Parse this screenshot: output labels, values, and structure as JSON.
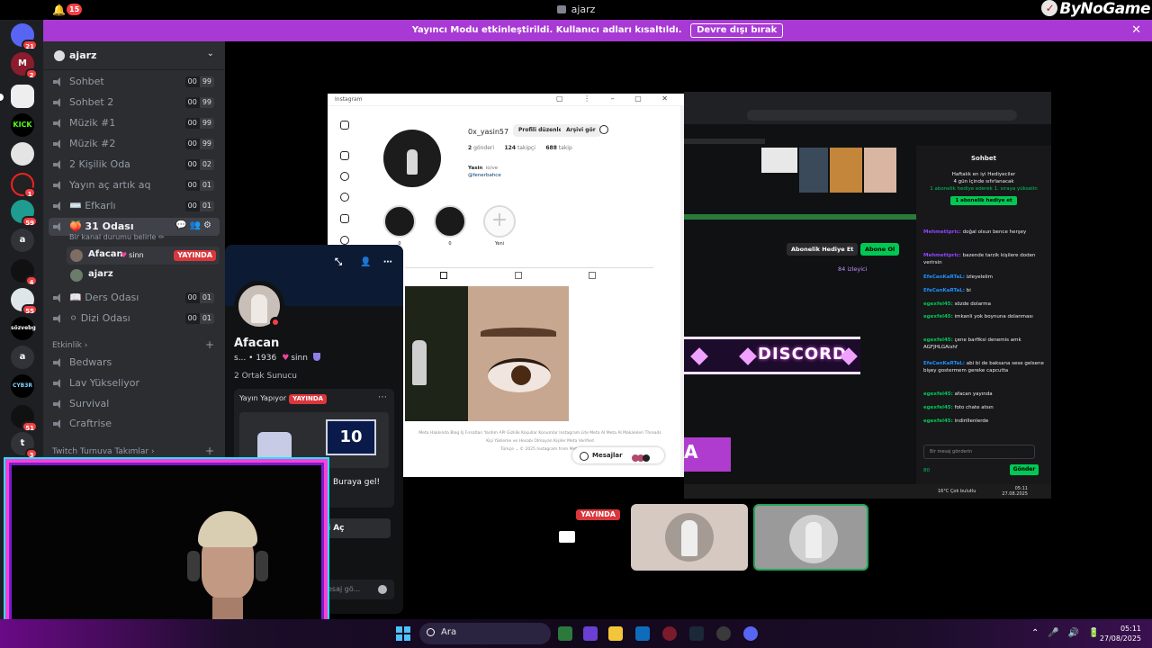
{
  "titlebar": {
    "notification_count": "15",
    "title": "ajarz",
    "watermark": "ByNoGame"
  },
  "banner": {
    "message": "Yayıncı Modu etkinleştirildi. Kullanıcı adları kısaltıldı.",
    "disable_label": "Devre dışı bırak",
    "close_glyph": "✕"
  },
  "rail": {
    "servers": [
      {
        "abbr": "",
        "badge": "21"
      },
      {
        "abbr": "M",
        "badge": "2"
      },
      {
        "abbr": "",
        "badge": ""
      },
      {
        "abbr": "KICK",
        "badge": ""
      },
      {
        "abbr": "",
        "badge": ""
      },
      {
        "abbr": "",
        "badge": "1"
      },
      {
        "abbr": "",
        "badge": "59"
      },
      {
        "abbr": "a",
        "badge": ""
      },
      {
        "abbr": "",
        "badge": "4"
      },
      {
        "abbr": "",
        "badge": "55"
      },
      {
        "abbr": "sözvebg",
        "badge": ""
      },
      {
        "abbr": "a",
        "badge": ""
      },
      {
        "abbr": "CYB3R",
        "badge": ""
      },
      {
        "abbr": "",
        "badge": "51"
      },
      {
        "abbr": "t",
        "badge": "3"
      }
    ]
  },
  "sidebar": {
    "server_name": "ajarz",
    "channels": [
      {
        "name": "Sohbet",
        "count": "00",
        "limit": "99"
      },
      {
        "name": "Sohbet 2",
        "count": "00",
        "limit": "99"
      },
      {
        "name": "Müzik #1",
        "count": "00",
        "limit": "99"
      },
      {
        "name": "Müzik #2",
        "count": "00",
        "limit": "99"
      },
      {
        "name": "2 Kişilik Oda",
        "count": "00",
        "limit": "02"
      },
      {
        "name": "Yayın aç artık aq",
        "count": "00",
        "limit": "01"
      },
      {
        "name": "⌨️ Efkarlı",
        "count": "00",
        "limit": "01"
      },
      {
        "name": "🍑 31 Odası",
        "count": "",
        "limit": ""
      },
      {
        "name": "📖 Ders Odası",
        "count": "00",
        "limit": "01"
      },
      {
        "name": "⚪ Dizi Odası",
        "count": "00",
        "limit": "01"
      }
    ],
    "active_channel_status": "Bir kanal durumu belirle ✏",
    "voice_users": [
      {
        "name": "Afacan",
        "tag": "sinn",
        "live": "YAYINDA"
      },
      {
        "name": "ajarz",
        "tag": "",
        "live": ""
      }
    ],
    "category_1": "Etkinlik ›",
    "category_1_channels": [
      "Bedwars",
      "Lav Yükseliyor",
      "Survival",
      "Craftrise"
    ],
    "category_2": "Twitch Turnuva Takımlar ›"
  },
  "instagram": {
    "window_title": "Instagram",
    "window_controls": "▢ ⋮ – ▢ ✕",
    "username": "0x_yasin57",
    "edit_profile": "Profili düzenle",
    "view_archive": "Arşivi gör",
    "stats": {
      "posts": "2",
      "posts_label": "gönderi",
      "followers": "124",
      "followers_label": "takipçi",
      "following": "688",
      "following_label": "takip"
    },
    "bio_name": "Yasin",
    "bio_pronoun": "io/ve",
    "bio_link": "@fenerbahce",
    "highlights": [
      {
        "label": "0"
      },
      {
        "label": "0"
      },
      {
        "label": "Yeni"
      }
    ],
    "footer_line1": "Meta  Hakkında  Blog  İş Fırsatları  Yardım  API  Gizlilik  Koşullar  Konumlar  Instagram Lite  Meta AI  Meta AI Makaleleri  Threads",
    "footer_line2": "Kişi Yükleme ve Hesabı Olmayan Kişiler  Meta Verified",
    "footer_line3": "Türkçe  ⌄   © 2025 Instagram from Meta",
    "messages_label": "Mesajlar"
  },
  "second_screen": {
    "chat_title": "Sohbet",
    "gift_title": "Haftalık en iyi Hediyeciler",
    "gift_sub": "4 gün içinde sıfırlanacak",
    "gift_line": "1 abonelik hediye ederek 1. sıraya yükselin",
    "gift_button": "1 abonelik hediye et",
    "gift_sub_button": "Abonelik Hediye Et",
    "subscribe_button": "Abone Ol",
    "viewers": "84 izleyici",
    "discord_text": "DISCORD",
    "banner_big": "A",
    "messages": [
      {
        "user": "Mehmettpric:",
        "text": "doğal olsun bence herşey",
        "color": "#9146ff"
      },
      {
        "user": "Mehmettpric:",
        "text": "bazende tarzik kişilere doden verirsin",
        "color": "#9146ff"
      },
      {
        "user": "EfeCanKaRTaL:",
        "text": "izleyelelim",
        "color": "#1e90ff"
      },
      {
        "user": "EfeCanKaRTaL:",
        "text": "bi",
        "color": "#1e90ff"
      },
      {
        "user": "egexfel45:",
        "text": "sözde dolarma",
        "color": "#00c853"
      },
      {
        "user": "egexfel45:",
        "text": "imkanli yok boynuna dolanması",
        "color": "#00c853"
      },
      {
        "user": "egexfel45:",
        "text": "çene barfiksi denemis amk AGFJHLGAishf",
        "color": "#00c853"
      },
      {
        "user": "EfeCanKaRTaL:",
        "text": "abi bi de baksana sese gelsene bişey gostermem gereke capcutta",
        "color": "#1e90ff"
      },
      {
        "user": "egexfel45:",
        "text": "afacan yayında",
        "color": "#00c853"
      },
      {
        "user": "egexfel45:",
        "text": "foto chate atsın",
        "color": "#00c853"
      },
      {
        "user": "egexfel45:",
        "text": "indirillenlerde",
        "color": "#00c853"
      }
    ],
    "input_placeholder": "Bir mesaj gönderin",
    "points": "80",
    "send_button": "Gönder",
    "weather": "16°C  Çok bulutlu",
    "time": "05:11",
    "date": "27.08.2025"
  },
  "profile": {
    "name": "Afacan",
    "sub_name": "s...",
    "sub_tag_number": "• 1936",
    "tag": "sinn",
    "mutual": "2 Ortak Sunucu",
    "card_label": "Yayın Yapıyor",
    "card_live": "YAYINDA",
    "tv_number": "10",
    "card_cta": "Buraya gel!",
    "join_button": "i Aç",
    "message_placeholder": "esaj gö..."
  },
  "tiles": {
    "live_label": "YAYINDA"
  },
  "taskbar": {
    "search_label": "Ara",
    "time": "05:11",
    "date": "27/08/2025"
  },
  "colors": {
    "streamer_banner": "#a839d4",
    "live_red": "#da373c",
    "twitch_green": "#00c853",
    "cam_border": "#ff3fd4"
  }
}
